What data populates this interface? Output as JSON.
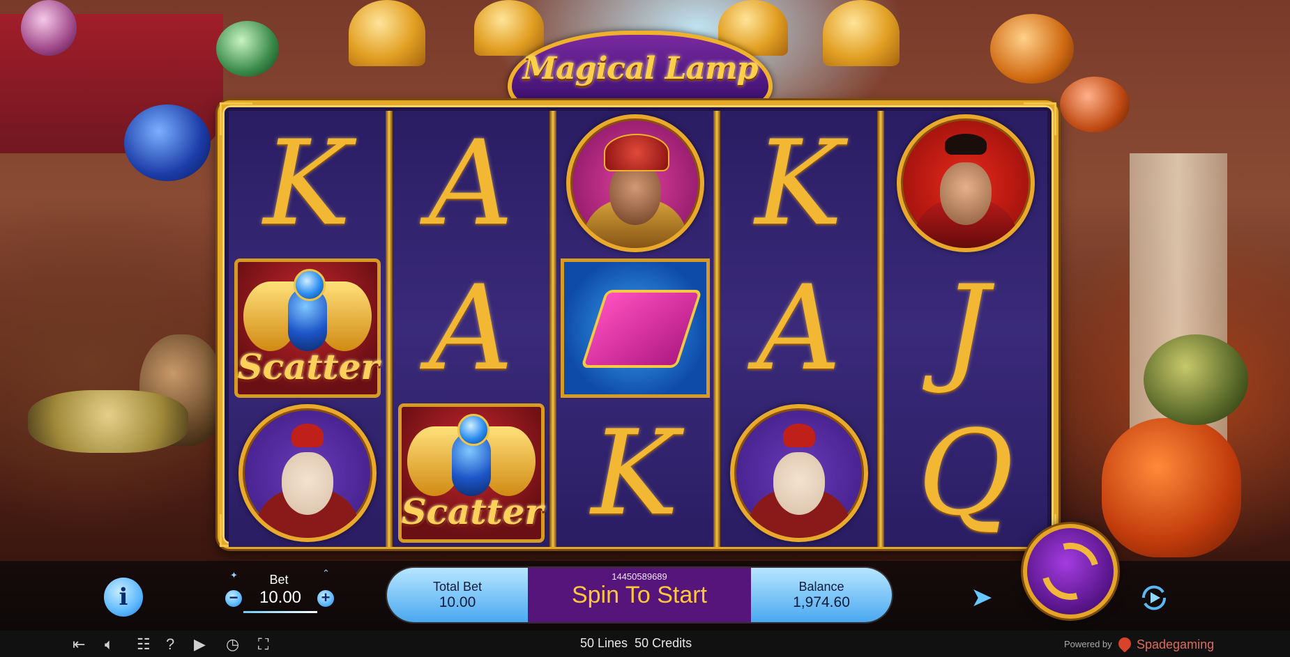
{
  "logo": {
    "title": "Magical Lamp"
  },
  "reels": [
    [
      "K",
      "scatter",
      "monkey"
    ],
    [
      "A",
      "A",
      "scatter"
    ],
    [
      "sultan",
      "carpet",
      "K"
    ],
    [
      "K",
      "A",
      "monkey"
    ],
    [
      "hero",
      "J",
      "Q"
    ]
  ],
  "symbols": {
    "scatter_label": "Scatter"
  },
  "controls": {
    "bet_label": "Bet",
    "bet_value": "10.00",
    "bet_minus": "−",
    "bet_plus": "+",
    "info": "i",
    "total_bet_label": "Total Bet",
    "total_bet_value": "10.00",
    "ticket_id": "14450589689",
    "spin_prompt": "Spin To Start",
    "balance_label": "Balance",
    "balance_value": "1,974.60"
  },
  "footer": {
    "lines": "50 Lines",
    "credits": "50 Credits",
    "powered_by": "Powered by",
    "brand": "Spadegaming"
  },
  "icons": {
    "exit": "exit-icon",
    "sound": "speaker-icon",
    "paytable": "paytable-icon",
    "help": "help-icon",
    "history": "play-history-icon",
    "settings": "clock-icon",
    "fullscreen": "fullscreen-icon",
    "turbo": "turbo-icon",
    "autoplay": "autoplay-icon",
    "spin": "spin-icon"
  },
  "colors": {
    "gold": "#f2b733",
    "purple": "#56157a",
    "sky_blue": "#4aa8f0",
    "reel_bg": "#2a1d63"
  }
}
